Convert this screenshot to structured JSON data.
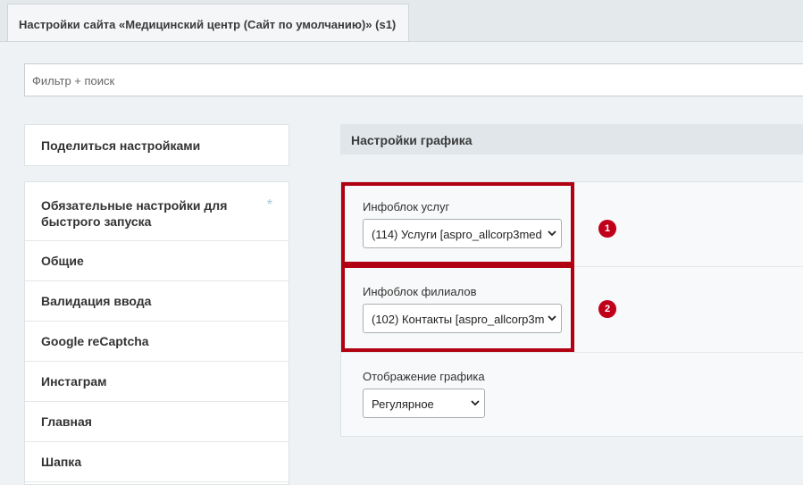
{
  "tab": {
    "title": "Настройки сайта «Медицинский центр (Сайт по умолчанию)» (s1)"
  },
  "filter": {
    "placeholder": "Фильтр + поиск"
  },
  "sidebar": {
    "share_label": "Поделиться настройками",
    "items": [
      {
        "label": "Обязательные настройки для быстрого запуска",
        "required_mark": "*"
      },
      {
        "label": "Общие"
      },
      {
        "label": "Валидация ввода"
      },
      {
        "label": "Google reCaptcha"
      },
      {
        "label": "Инстаграм"
      },
      {
        "label": "Главная"
      },
      {
        "label": "Шапка"
      }
    ]
  },
  "main": {
    "section_title": "Настройки графика",
    "fields": [
      {
        "label": "Инфоблок услуг",
        "value": "(114) Услуги [aspro_allcorp3med",
        "badge": "1"
      },
      {
        "label": "Инфоблок филиалов",
        "value": "(102) Контакты [aspro_allcorp3m",
        "badge": "2"
      },
      {
        "label": "Отображение графика",
        "value": "Регулярное"
      }
    ]
  },
  "colors": {
    "highlight": "#b00012",
    "badge": "#c0001a"
  }
}
